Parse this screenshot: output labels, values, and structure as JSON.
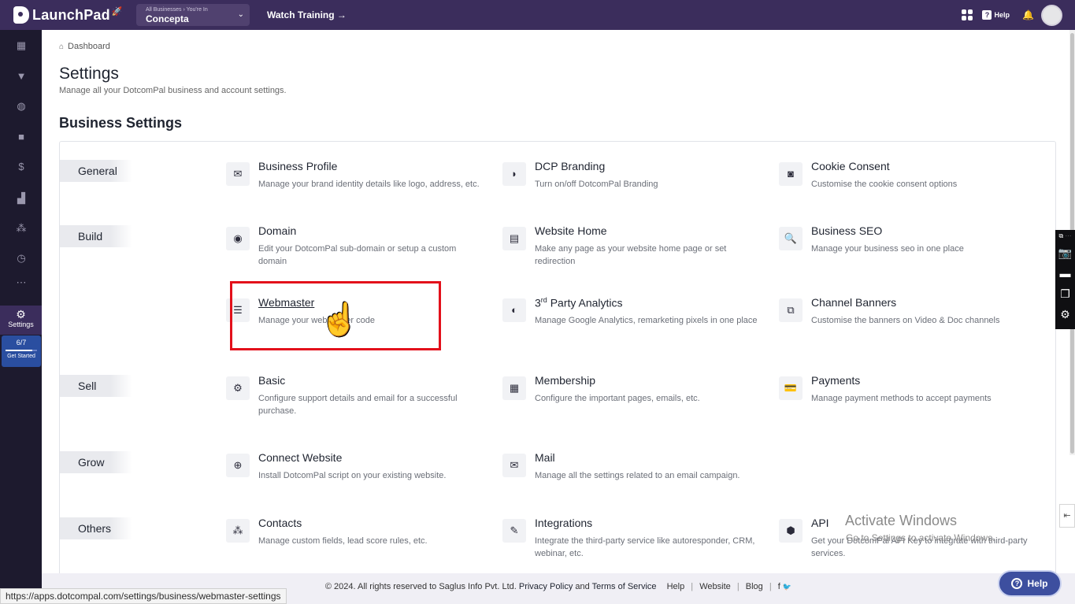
{
  "topbar": {
    "app_name": "LaunchPad",
    "business_context": "All Businesses › You're In",
    "business_name": "Concepta",
    "watch_training": "Watch Training →",
    "help": "Help"
  },
  "sidebar": {
    "active_label": "Settings",
    "progress_text": "6/7",
    "progress_value": 0.857,
    "get_started": "Get Started"
  },
  "breadcrumb": "Dashboard",
  "page": {
    "title": "Settings",
    "subtitle": "Manage all your DotcomPal business and account settings.",
    "section_title": "Business Settings"
  },
  "categories": {
    "general": "General",
    "build": "Build",
    "sell": "Sell",
    "grow": "Grow",
    "others": "Others"
  },
  "items": {
    "business_profile": {
      "title": "Business Profile",
      "desc": "Manage your brand identity details like logo, address, etc."
    },
    "dcp_branding": {
      "title": "DCP Branding",
      "desc": "Turn on/off DotcomPal Branding"
    },
    "cookie_consent": {
      "title": "Cookie Consent",
      "desc": "Customise the cookie consent options"
    },
    "domain": {
      "title": "Domain",
      "desc": "Edit your DotcomPal sub-domain or setup a custom domain"
    },
    "website_home": {
      "title": "Website Home",
      "desc": "Make any page as your website home page or set redirection"
    },
    "business_seo": {
      "title": "Business SEO",
      "desc": "Manage your business seo in one place"
    },
    "webmaster": {
      "title": "Webmaster",
      "desc": "Manage your webmaster code"
    },
    "third_party_analytics": {
      "title_prefix": "3",
      "title_sup": "rd",
      "title_rest": " Party Analytics",
      "desc": "Manage Google Analytics, remarketing pixels in one place"
    },
    "channel_banners": {
      "title": "Channel Banners",
      "desc": "Customise the banners on Video & Doc channels"
    },
    "basic": {
      "title": "Basic",
      "desc": "Configure support details and email for a successful purchase."
    },
    "membership": {
      "title": "Membership",
      "desc": "Configure the important pages, emails, etc."
    },
    "payments": {
      "title": "Payments",
      "desc": "Manage payment methods to accept payments"
    },
    "connect_website": {
      "title": "Connect Website",
      "desc": "Install DotcomPal script on your existing website."
    },
    "mail": {
      "title": "Mail",
      "desc": "Manage all the settings related to an email campaign."
    },
    "contacts": {
      "title": "Contacts",
      "desc": "Manage custom fields, lead score rules, etc."
    },
    "integrations": {
      "title": "Integrations",
      "desc": "Integrate the third-party service like autoresponder, CRM, webinar, etc."
    },
    "api": {
      "title": "API",
      "desc": "Get your DotcomPal API Key to integrate with third-party services."
    }
  },
  "footer": {
    "copyright": "© 2024. All rights reserved to Saglus Info Pvt. Ltd.",
    "privacy": "Privacy Policy",
    "and": "and",
    "terms": "Terms of Service",
    "help": "Help",
    "website": "Website",
    "blog": "Blog",
    "facebook": "f",
    "twitter": "🐦"
  },
  "help_button": "Help",
  "status_url": "https://apps.dotcompal.com/settings/business/webmaster-settings",
  "watermark": {
    "title": "Activate Windows",
    "sub": "Go to Settings to activate Windows."
  },
  "colors": {
    "topbar": "#3b2d5c",
    "sidebar": "#1d1a2e",
    "highlight": "#e3101b",
    "help_button": "#3d4f9f"
  }
}
